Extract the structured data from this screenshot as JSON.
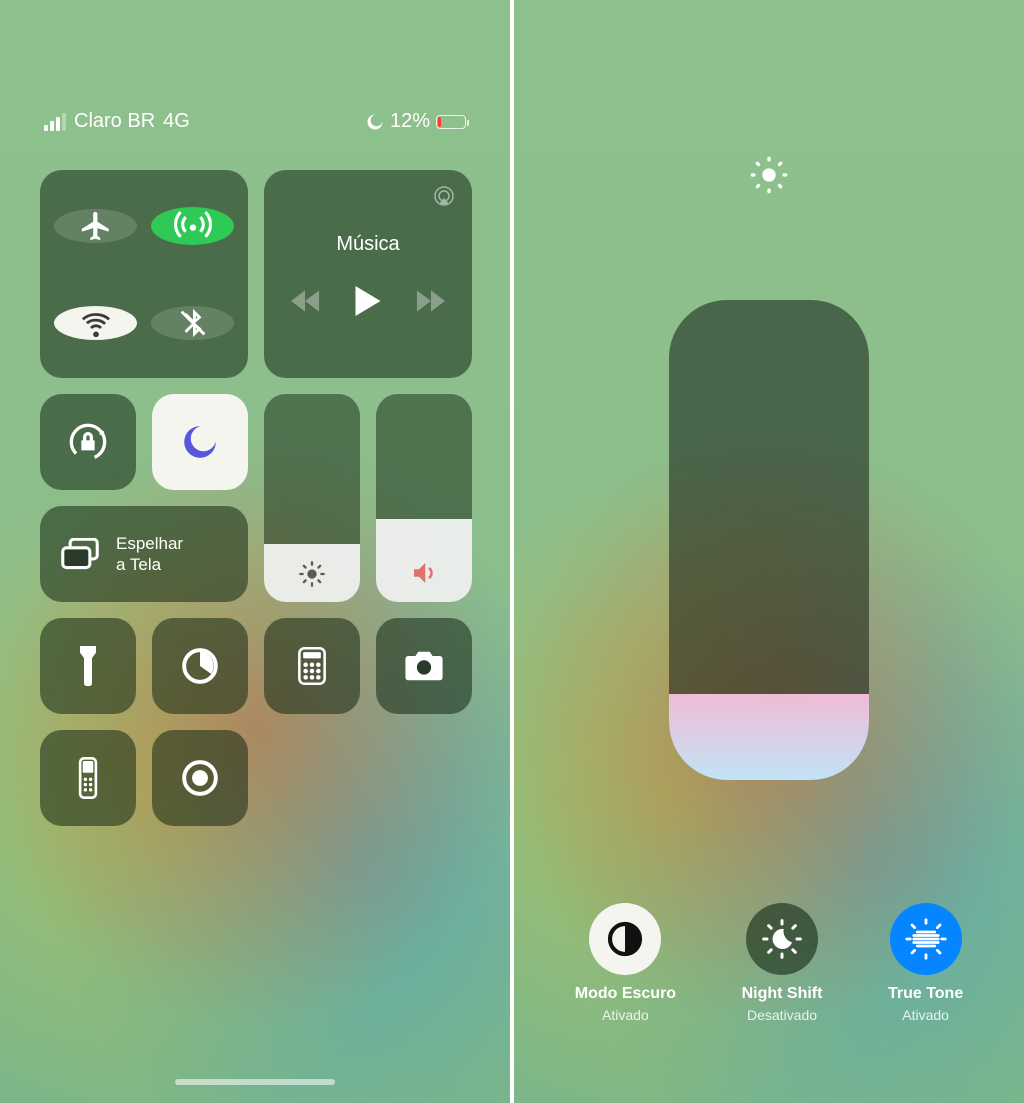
{
  "status": {
    "carrier": "Claro BR",
    "network": "4G",
    "battery_pct": "12%"
  },
  "media": {
    "title": "Música"
  },
  "mirror": {
    "line1": "Espelhar",
    "line2": "a Tela"
  },
  "sliders": {
    "brightness_pct": 28,
    "volume_pct": 40,
    "big_brightness_pct": 18
  },
  "options": {
    "dark_mode": {
      "title": "Modo Escuro",
      "subtitle": "Ativado"
    },
    "night_shift": {
      "title": "Night Shift",
      "subtitle": "Desativado"
    },
    "true_tone": {
      "title": "True Tone",
      "subtitle": "Ativado"
    }
  }
}
